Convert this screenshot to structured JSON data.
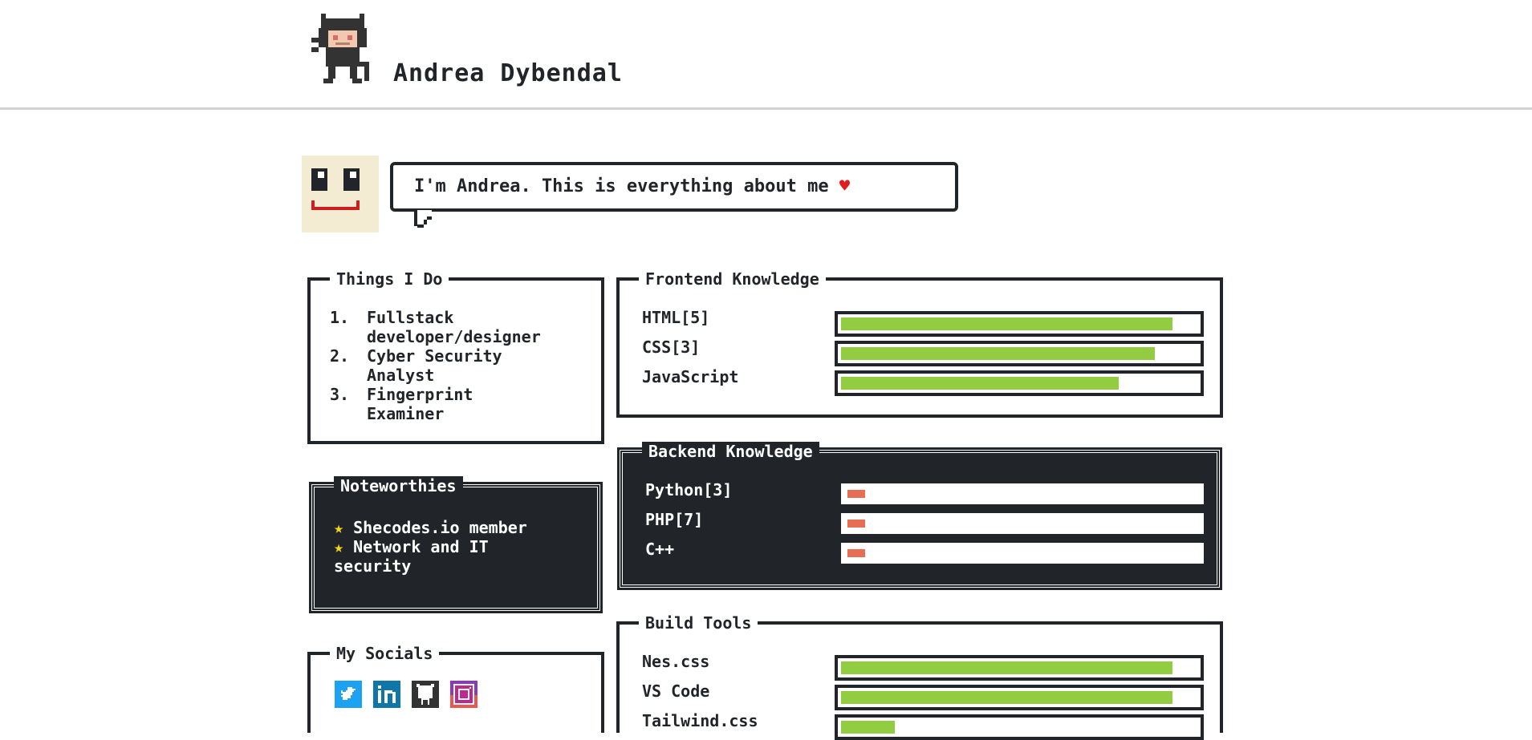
{
  "header": {
    "title": "Andrea Dybendal"
  },
  "intro": {
    "message": "I'm Andrea. This is everything about me",
    "heart": "♥"
  },
  "things": {
    "title": "Things I Do",
    "items": [
      {
        "num": "1.",
        "text": "Fullstack developer/designer"
      },
      {
        "num": "2.",
        "text": "Cyber Security Analyst"
      },
      {
        "num": "3.",
        "text": "Fingerprint Examiner"
      }
    ]
  },
  "noteworthies": {
    "title": "Noteworthies",
    "star": "★",
    "items": [
      "Shecodes.io member",
      "Network and IT security"
    ]
  },
  "socials": {
    "title": "My Socials",
    "icons": [
      "twitter-icon",
      "linkedin-icon",
      "github-icon",
      "instagram-icon"
    ]
  },
  "frontend": {
    "title": "Frontend Knowledge",
    "skills": [
      {
        "name": "HTML[5]",
        "level": 0.93
      },
      {
        "name": "CSS[3]",
        "level": 0.88
      },
      {
        "name": "JavaScript",
        "level": 0.78
      }
    ]
  },
  "backend": {
    "title": "Backend Knowledge",
    "skills": [
      {
        "name": "Python[3]",
        "level": 0.05
      },
      {
        "name": "PHP[7]",
        "level": 0.05
      },
      {
        "name": "C++",
        "level": 0.05
      }
    ]
  },
  "build": {
    "title": "Build Tools",
    "skills": [
      {
        "name": "Nes.css",
        "level": 0.93
      },
      {
        "name": "VS Code",
        "level": 0.93
      },
      {
        "name": "Tailwind.css",
        "level": 0.15
      }
    ]
  },
  "colors": {
    "success": "#92cc41",
    "error": "#e76e55",
    "dark": "#212529",
    "warning": "#f7d51d"
  }
}
